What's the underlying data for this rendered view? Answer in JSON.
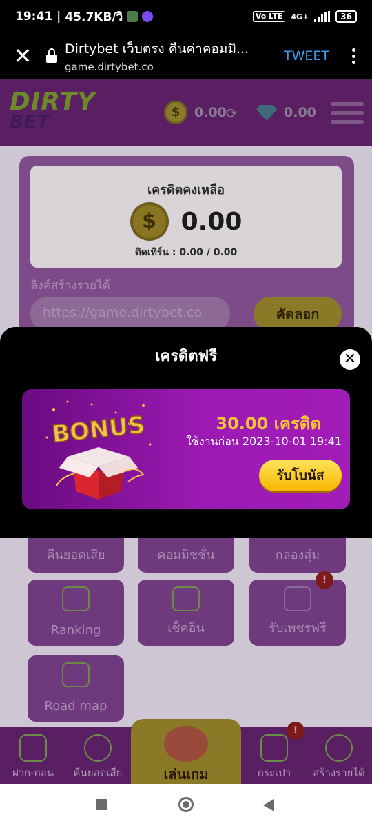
{
  "status_bar": {
    "time": "19:41",
    "speed": "45.7KB/วิ",
    "network_label": "4G+",
    "volte_label": "Vo LTE",
    "battery": "36"
  },
  "browser": {
    "page_title": "Dirtybet เว็บตรง คืนค่าคอมมิ...",
    "url": "game.dirtybet.co",
    "tweet_label": "TWEET"
  },
  "site": {
    "logo_line1": "DIRTY",
    "logo_line2": "BET",
    "credit": "0.00",
    "diamond": "0.00"
  },
  "balance": {
    "title": "เครดิตคงเหลือ",
    "amount": "0.00",
    "turnover": "ติดเทิร์น : 0.00 / 0.00"
  },
  "referral": {
    "label": "ลิงค์สร้างรายได้",
    "link": "https://game.dirtybet.co",
    "copy_label": "คัดลอก"
  },
  "tiles": [
    {
      "label": "คืนยอดเสีย"
    },
    {
      "label": "คอมมิชชั่น"
    },
    {
      "label": "กล่องสุ่ม"
    },
    {
      "label": "Ranking"
    },
    {
      "label": "เช็คอิน"
    },
    {
      "label": "รับเพชรฟรี",
      "badge": "!"
    },
    {
      "label": "Road map"
    }
  ],
  "bottom_nav": [
    {
      "label": "ฝาก-ถอน"
    },
    {
      "label": "คืนยอดเสีย"
    },
    {
      "label": "เล่นเกม"
    },
    {
      "label": "กระเป๋า",
      "badge": "!"
    },
    {
      "label": "สร้างรายได้"
    }
  ],
  "modal": {
    "title": "เครดิตฟรี",
    "close_symbol": "✕",
    "bonus_art_text": "BONUS",
    "bonus_amount": "30.00 เครดิต",
    "expire": "ใช้งานก่อน 2023-10-01 19:41",
    "claim_label": "รับโบนัส"
  },
  "colors": {
    "brand_purple": "#9c1ab3",
    "gold": "#f6c532",
    "button_yellow": "#f7b500"
  }
}
